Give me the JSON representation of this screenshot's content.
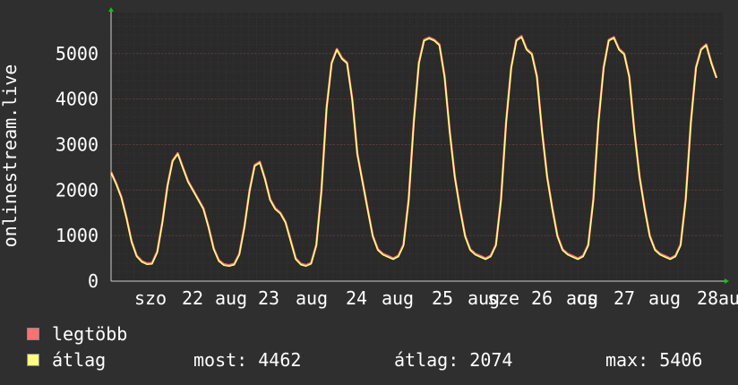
{
  "chart_data": {
    "type": "line",
    "ylabel": "onlinestream.live",
    "ylim": [
      0,
      5900
    ],
    "y_ticks": [
      0,
      1000,
      2000,
      3000,
      4000,
      5000
    ],
    "x_tick_labels": [
      "szo",
      "22",
      "aug",
      "23",
      "aug",
      "24",
      "aug",
      "25",
      "aug",
      "sze",
      "26",
      "aug",
      "cs",
      "27",
      "aug",
      "28",
      "aug"
    ],
    "grid": true,
    "series": [
      {
        "name": "legtöbb",
        "color": "#ff7070",
        "y": [
          2400,
          2150,
          1850,
          1400,
          880,
          560,
          440,
          390,
          400,
          650,
          1300,
          2100,
          2650,
          2810,
          2500,
          2200,
          2000,
          1800,
          1600,
          1200,
          720,
          460,
          370,
          350,
          380,
          600,
          1200,
          2000,
          2550,
          2620,
          2250,
          1800,
          1600,
          1500,
          1300,
          900,
          500,
          380,
          350,
          400,
          800,
          2000,
          3800,
          4800,
          5100,
          4900,
          4800,
          4000,
          2800,
          2200,
          1600,
          1000,
          700,
          600,
          550,
          500,
          560,
          800,
          1800,
          3500,
          4800,
          5300,
          5350,
          5300,
          5200,
          4500,
          3300,
          2300,
          1600,
          1000,
          700,
          600,
          550,
          500,
          560,
          800,
          1800,
          3500,
          4700,
          5300,
          5380,
          5100,
          5000,
          4500,
          3300,
          2300,
          1600,
          1000,
          700,
          600,
          550,
          500,
          560,
          800,
          1800,
          3500,
          4700,
          5300,
          5360,
          5100,
          5000,
          4500,
          3300,
          2300,
          1600,
          1000,
          700,
          600,
          550,
          500,
          560,
          800,
          1800,
          3500,
          4700,
          5100,
          5200,
          4800,
          4470
        ]
      },
      {
        "name": "átlag",
        "color": "#ffff80",
        "y": [
          2380,
          2130,
          1830,
          1380,
          860,
          540,
          420,
          370,
          380,
          630,
          1280,
          2080,
          2630,
          2790,
          2480,
          2180,
          1980,
          1780,
          1580,
          1180,
          700,
          440,
          350,
          330,
          360,
          580,
          1180,
          1980,
          2530,
          2600,
          2230,
          1780,
          1580,
          1480,
          1280,
          880,
          480,
          360,
          330,
          380,
          780,
          1980,
          3780,
          4780,
          5080,
          4880,
          4780,
          3980,
          2780,
          2180,
          1580,
          980,
          680,
          580,
          530,
          480,
          540,
          780,
          1780,
          3480,
          4780,
          5280,
          5330,
          5280,
          5180,
          4480,
          3280,
          2280,
          1580,
          980,
          680,
          580,
          530,
          480,
          540,
          780,
          1780,
          3480,
          4680,
          5280,
          5360,
          5080,
          4980,
          4480,
          3280,
          2280,
          1580,
          980,
          680,
          580,
          530,
          480,
          540,
          780,
          1780,
          3480,
          4680,
          5280,
          5340,
          5080,
          4980,
          4480,
          3280,
          2280,
          1580,
          980,
          680,
          580,
          530,
          480,
          540,
          780,
          1780,
          3480,
          4680,
          5080,
          5180,
          4780,
          4462
        ]
      }
    ]
  },
  "legend": [
    {
      "label": "legtöbb",
      "color": "#ff7070"
    },
    {
      "label": "átlag",
      "color": "#ffff80"
    }
  ],
  "stats": {
    "most": "most: 4462",
    "atlag": "átlag: 2074",
    "max": "max: 5406"
  },
  "colors": {
    "background": "#2f2f2f",
    "plot_bg": "#2a2a2a",
    "grid": "#5a3a3a",
    "arrow": "#00cc00"
  }
}
